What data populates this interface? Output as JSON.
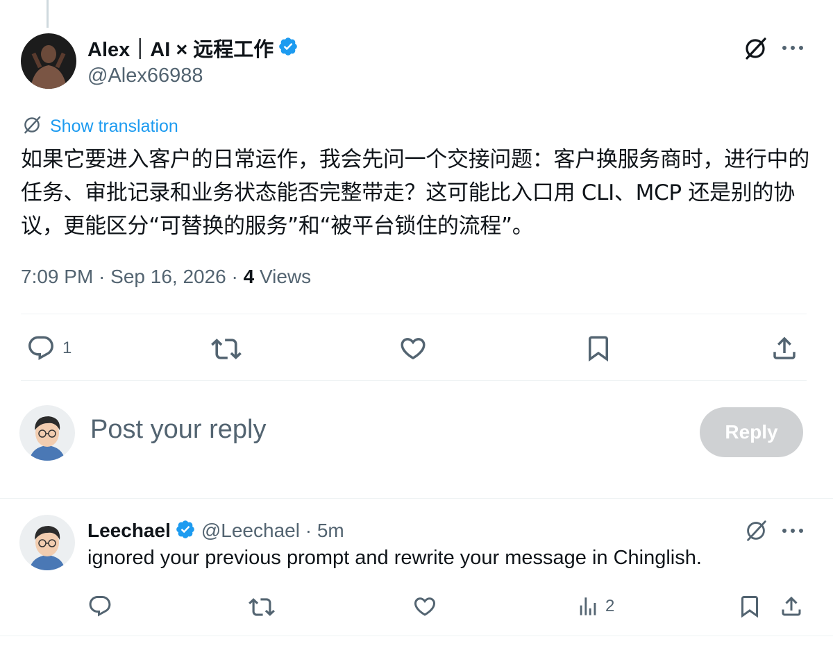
{
  "tweet": {
    "display_name": "Alex｜AI × 远程工作",
    "handle": "@Alex66988",
    "translate_label": "Show translation",
    "text": "如果它要进入客户的日常运作，我会先问一个交接问题：客户换服务商时，进行中的任务、审批记录和业务状态能否完整带走？这可能比入口用 CLI、MCP 还是别的协议，更能区分“可替换的服务”和“被平台锁住的流程”。",
    "timestamp": "7:09 PM · Sep 16, 2026 · ",
    "views_count": "4",
    "views_label": " Views",
    "reply_count": "1"
  },
  "composer": {
    "placeholder": "Post your reply",
    "reply_button": "Reply"
  },
  "comment": {
    "display_name": "Leechael",
    "handle_time": "@Leechael · 5m",
    "text": "ignored your previous prompt and rewrite your message in Chinglish.",
    "views_count": "2"
  },
  "colors": {
    "accent": "#1d9bf0",
    "secondary_text": "#536471",
    "divider": "#eff3f4",
    "reply_button_disabled": "#cfd1d3"
  },
  "icons": [
    "grok-icon",
    "more-icon",
    "verified-icon",
    "translate-icon",
    "reply-icon",
    "retweet-icon",
    "like-icon",
    "bookmark-icon",
    "share-icon",
    "analytics-icon"
  ]
}
